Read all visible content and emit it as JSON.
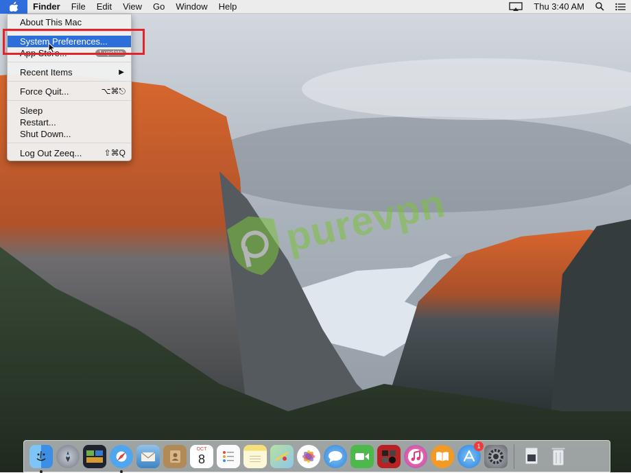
{
  "menubar": {
    "app_name": "Finder",
    "menus": [
      "File",
      "Edit",
      "View",
      "Go",
      "Window",
      "Help"
    ],
    "clock": "Thu 3:40 AM",
    "right_icons": [
      "airplay-icon",
      "search-icon",
      "notification-center-icon"
    ]
  },
  "apple_menu": {
    "about": "About This Mac",
    "system_preferences": "System Preferences...",
    "app_store": "App Store...",
    "app_store_badge": "1 update",
    "recent_items": "Recent Items",
    "force_quit": "Force Quit...",
    "force_quit_shortcut": "⌥⌘⎋",
    "sleep": "Sleep",
    "restart": "Restart...",
    "shut_down": "Shut Down...",
    "log_out": "Log Out Zeeq...",
    "log_out_shortcut": "⇧⌘Q"
  },
  "watermark": "purevpn",
  "dock": {
    "calendar_month": "OCT",
    "calendar_day": "8",
    "app_store_badge": "1",
    "icons": [
      "finder-icon",
      "launchpad-icon",
      "mission-control-icon",
      "safari-icon",
      "mail-icon",
      "contacts-icon",
      "calendar-icon",
      "reminders-icon",
      "notes-icon",
      "maps-icon",
      "photos-icon",
      "messages-icon",
      "facetime-icon",
      "photo-booth-icon",
      "itunes-icon",
      "ibooks-icon",
      "app-store-icon",
      "system-preferences-icon",
      "downloads-icon",
      "trash-icon"
    ]
  },
  "colors": {
    "selection": "#2c6fdb",
    "highlight_box": "#e2232a",
    "watermark": "#7cc23c"
  }
}
